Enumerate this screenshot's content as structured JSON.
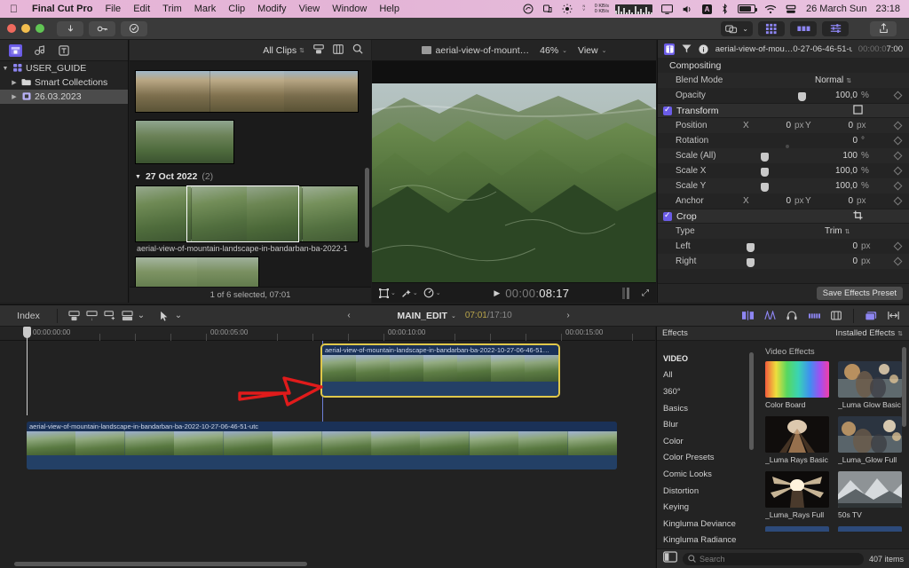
{
  "menubar": {
    "apple_icon": "apple-icon",
    "items": [
      {
        "label": "Final Cut Pro",
        "bold": true
      },
      {
        "label": "File"
      },
      {
        "label": "Edit"
      },
      {
        "label": "Trim"
      },
      {
        "label": "Mark"
      },
      {
        "label": "Clip"
      },
      {
        "label": "Modify"
      },
      {
        "label": "View"
      },
      {
        "label": "Window"
      },
      {
        "label": "Help"
      }
    ],
    "status": {
      "net_up": "0 KB/s",
      "net_down": "0 KB/s",
      "input_source": "A",
      "date": "26 March Sun",
      "time": "23:18"
    }
  },
  "toolbar": {
    "import_label": "⭣",
    "keyword_label": "⚷",
    "analyze_label": "⊘",
    "media_label": "▤",
    "effects_label": "▥",
    "adjust_label": "⛭",
    "share_label": "⇪"
  },
  "sidebar": {
    "icons": [
      "library-icon",
      "photos-audio-icon",
      "titles-generators-icon"
    ],
    "items": [
      {
        "label": "USER_GUIDE",
        "icon": "library-icon",
        "indent": 0,
        "selected": false,
        "disclosure": "▼"
      },
      {
        "label": "Smart Collections",
        "icon": "folder-icon",
        "indent": 1,
        "selected": false,
        "disclosure": "▶"
      },
      {
        "label": "26.03.2023",
        "icon": "event-icon",
        "indent": 1,
        "selected": true,
        "disclosure": "▶"
      }
    ]
  },
  "browser": {
    "filter_label": "All Clips",
    "icons": [
      "filmstrip-view-icon",
      "list-view-icon",
      "search-icon"
    ],
    "date_group": {
      "label": "27 Oct 2022",
      "count": "(2)"
    },
    "clip_name": "aerial-view-of-mountain-landscape-in-bandarban-ba-2022-1",
    "status": "1 of 6 selected, 07:01"
  },
  "viewer": {
    "title": "aerial-view-of-mount…",
    "zoom": "46%",
    "view_menu": "View",
    "timecode_dim": "00:00:",
    "timecode_bright": "08:17",
    "play_icon": "play-icon",
    "transform_icon": "transform-icon",
    "enhance_icon": "enhancement-icon",
    "speed_icon": "retime-icon",
    "fullscreen_icon": "fullscreen-icon"
  },
  "inspector": {
    "icons": [
      "video-inspector-icon",
      "color-inspector-icon",
      "info-inspector-icon"
    ],
    "clip_name": "aerial-view-of-mou…0-27-06-46-51-utc",
    "timecode_dim": "00:00:0",
    "timecode_bright": "7:00",
    "section_compositing": "Compositing",
    "rows": [
      {
        "label": "Blend Mode",
        "value": "Normal",
        "type": "popup"
      },
      {
        "label": "Opacity",
        "value": "100,0",
        "unit": "%",
        "type": "slider",
        "pos": 0.86
      }
    ],
    "transform": {
      "label": "Transform",
      "checked": true,
      "rows": [
        {
          "label": "Position",
          "axis_x": "X",
          "vx": "0",
          "ux": "px",
          "axis_y": "Y",
          "vy": "0",
          "uy": "px",
          "type": "xy"
        },
        {
          "label": "Rotation",
          "value": "0",
          "unit": "°",
          "type": "dial"
        },
        {
          "label": "Scale (All)",
          "value": "100",
          "unit": "%",
          "type": "slider",
          "pos": 0.25
        },
        {
          "label": "Scale X",
          "value": "100,0",
          "unit": "%",
          "type": "slider",
          "pos": 0.25
        },
        {
          "label": "Scale Y",
          "value": "100,0",
          "unit": "%",
          "type": "slider",
          "pos": 0.25
        },
        {
          "label": "Anchor",
          "axis_x": "X",
          "vx": "0",
          "ux": "px",
          "axis_y": "Y",
          "vy": "0",
          "uy": "px",
          "type": "xy"
        }
      ]
    },
    "crop": {
      "label": "Crop",
      "checked": true,
      "rows": [
        {
          "label": "Type",
          "value": "Trim",
          "type": "popup"
        },
        {
          "label": "Left",
          "value": "0",
          "unit": "px",
          "type": "slider",
          "pos": 0.0
        },
        {
          "label": "Right",
          "value": "0",
          "unit": "px",
          "type": "slider",
          "pos": 0.0
        }
      ]
    },
    "save_preset": "Save Effects Preset"
  },
  "timeline_toolbar": {
    "index_label": "Index",
    "project_name": "MAIN_EDIT",
    "position_tc": "07:01",
    "total_tc": "17:10",
    "separator": "/",
    "back_icon": "chevron-left-icon",
    "forward_icon": "chevron-right-icon",
    "tool_icons": [
      "connect-clip-icon",
      "insert-clip-icon",
      "append-clip-icon",
      "overwrite-clip-icon"
    ],
    "select_tool_icon": "select-tool-icon",
    "right_icons": [
      "trim-icon",
      "audio-skimming-icon",
      "solo-icon",
      "audio-meter-icon",
      "clip-appearance-icon",
      "timeline-index-icon",
      "fit-icon"
    ]
  },
  "timeline": {
    "ruler_labels": [
      "00:00:00:00",
      "00:00:05:00",
      "00:00:10:00",
      "00:00:15:00"
    ],
    "connected_clip": {
      "name": "aerial-view-of-mountain-landscape-in-bandarban-ba-2022-10-27-06-46-51…",
      "selected": true
    },
    "storyline_clip": {
      "name": "aerial-view-of-mountain-landscape-in-bandarban-ba-2022-10-27-06-46-51-utc",
      "selected": false
    }
  },
  "effects": {
    "panel_title": "Effects",
    "installed_label": "Installed Effects",
    "group_label": "VIDEO",
    "categories": [
      "All",
      "360°",
      "Basics",
      "Blur",
      "Color",
      "Color Presets",
      "Comic Looks",
      "Distortion",
      "Keying",
      "Kingluma Deviance",
      "Kingluma Radiance"
    ],
    "grid_title": "Video Effects",
    "items": [
      {
        "label": "Color Board",
        "thumb": "colorboard"
      },
      {
        "label": "_Luma Glow Basic",
        "thumb": "glow"
      },
      {
        "label": "_Luma Rays Basic",
        "thumb": "rays"
      },
      {
        "label": "_Luma_Glow Full",
        "thumb": "glowfull"
      },
      {
        "label": "_Luma_Rays Full",
        "thumb": "raysfull"
      },
      {
        "label": "50s TV",
        "thumb": "tv"
      }
    ],
    "search_placeholder": "Search",
    "count": "407 items",
    "sidebar_toggle_icon": "sidebar-toggle-icon",
    "search_icon": "search-icon"
  },
  "annotation": {
    "arrow_color": "#e01b1b",
    "name": "red-arrow-annotation"
  },
  "colors": {
    "accent_purple": "#6b5ce7",
    "selection_yellow": "#e0c84a",
    "clip_blue": "#25436e",
    "menubar_pink": "#e7b6d8"
  }
}
